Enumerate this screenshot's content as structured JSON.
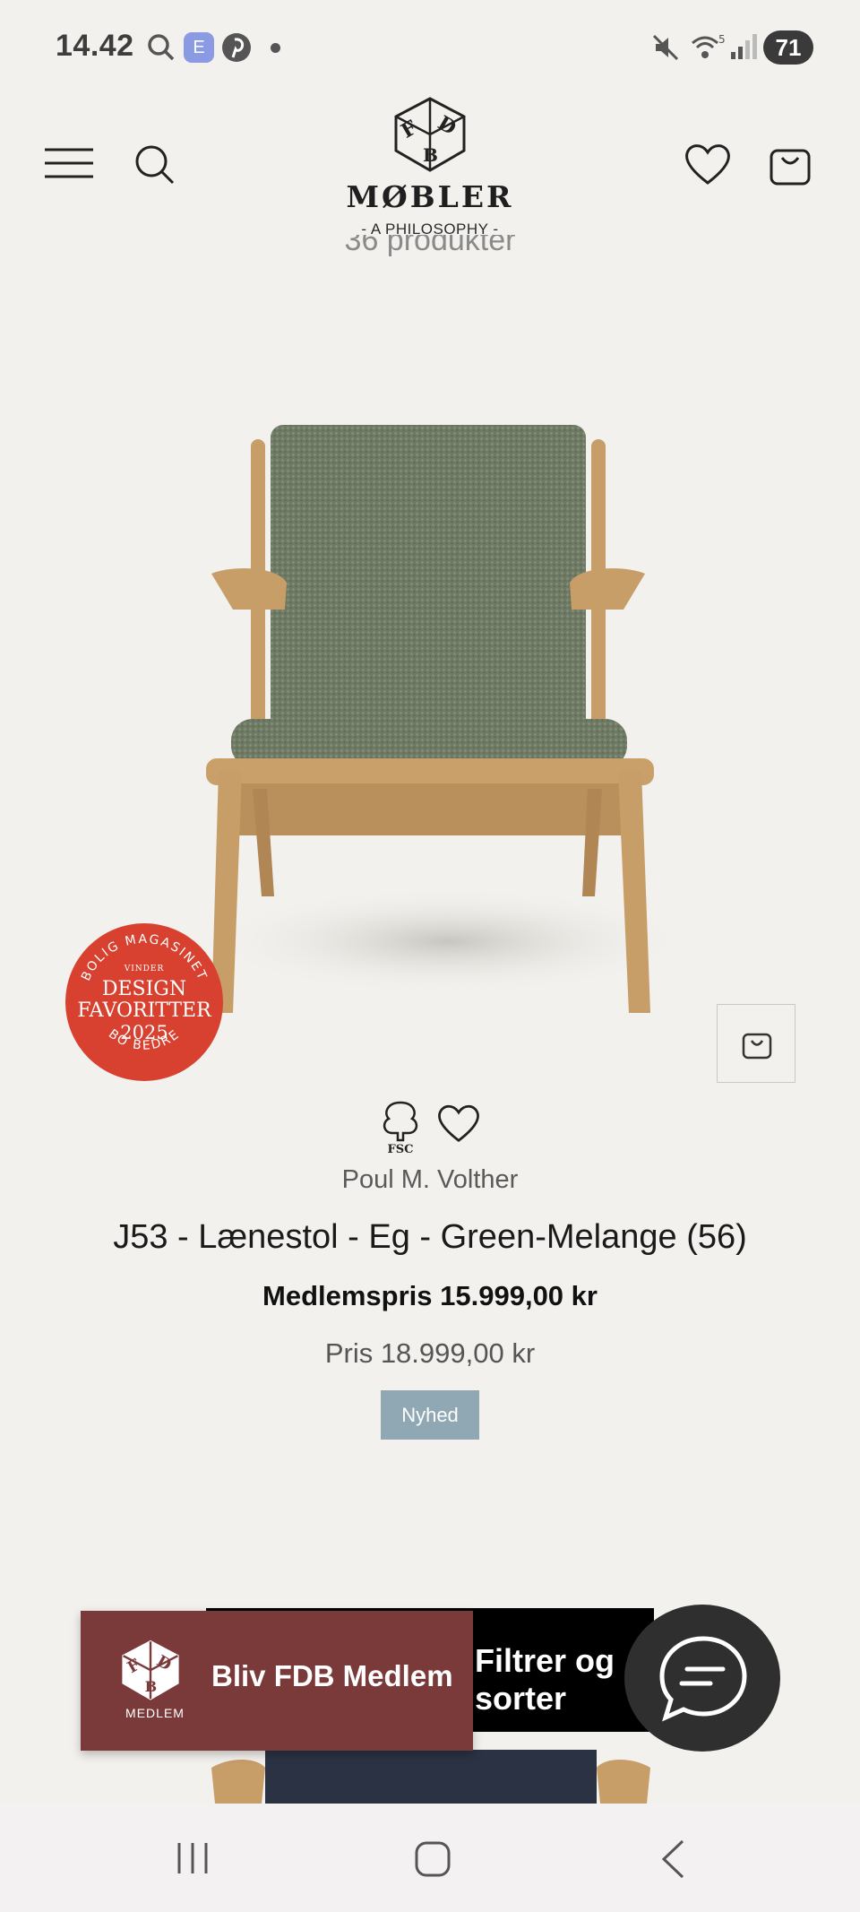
{
  "status_bar": {
    "time": "14.42",
    "notification_badge_letter": "E",
    "battery_level": "71"
  },
  "header": {
    "brand_name": "MØBLER",
    "brand_tagline": "- A PHILOSOPHY -",
    "logo_letters": [
      "F",
      "D",
      "B"
    ],
    "peek_text": "36 produkter"
  },
  "product": {
    "award_badge": {
      "arc_top": "BOLIG MAGASINET",
      "small": "VINDER",
      "big_line1": "DESIGN",
      "big_line2": "FAVORITTER",
      "year": "2025",
      "arc_bottom": "BO BEDRE"
    },
    "certification": "FSC",
    "designer": "Poul M. Volther",
    "title": "J53 - Lænestol - Eg - Green-Melange (56)",
    "member_price": "Medlemspris 15.999,00 kr",
    "regular_price": "Pris 18.999,00 kr",
    "badge": "Nyhed"
  },
  "overlays": {
    "filter_sort_label": "Filtrer og sorter",
    "member_banner_label": "Bliv FDB Medlem",
    "member_logo_caption": "MEDLEM"
  },
  "colors": {
    "background": "#f2f1ed",
    "award_red": "#d8412f",
    "new_badge": "#8fa8b3",
    "member_banner": "#7a3a3a",
    "chat_bubble": "#2f2f2f"
  }
}
